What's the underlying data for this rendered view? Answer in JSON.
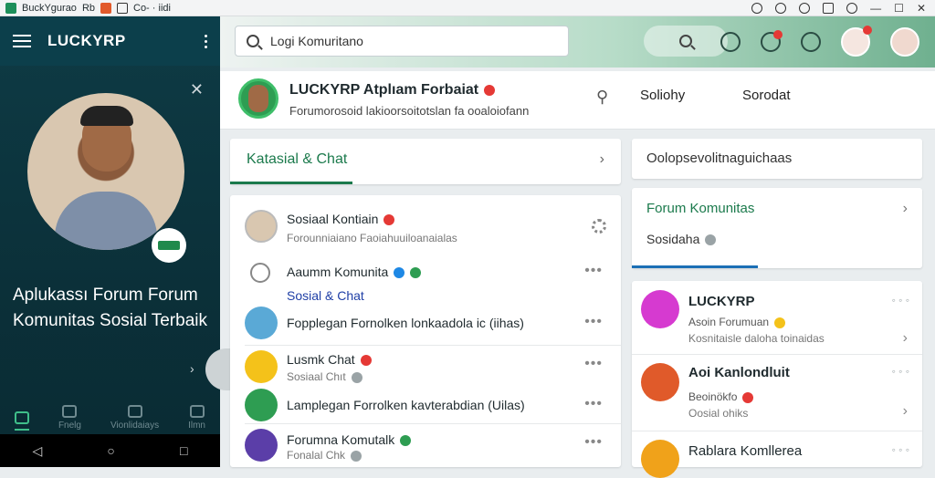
{
  "titlebar": {
    "app_title": "BuckYgurao",
    "app_suffix": "Rb",
    "extra": "Co- · iidi",
    "icons": [
      "minimize-icon",
      "maximize-icon",
      "close-icon"
    ],
    "min": "—",
    "max": "☐",
    "close": "✕"
  },
  "sidebar": {
    "brand": "LUCKYRP",
    "close": "✕",
    "tagline": "Aplukassı Forum Forum Komunitas Sosial Terbaik",
    "chevron": "›",
    "tabs": [
      {
        "label": "",
        "icon": "home-icon"
      },
      {
        "label": "Fnelg",
        "icon": "chat-icon"
      },
      {
        "label": "Vionlidaiays",
        "icon": "bell-icon"
      },
      {
        "label": "Ilmn",
        "icon": "grid-icon"
      }
    ],
    "nav": {
      "back": "◁",
      "home": "○",
      "recent": "□"
    }
  },
  "appbar": {
    "search_placeholder": "Logi Komuritano",
    "badge_count": "1"
  },
  "profile": {
    "title": "LUCKYRP Atplıam Forbaiat",
    "subtitle": "Forumorosoid lakioorsoitotslan fa ooaloiofann",
    "link1": "Soliohy",
    "link2": "Sorodat"
  },
  "tabs": {
    "active": "Katasial & Chat",
    "chevron": "›"
  },
  "list": [
    {
      "title": "Sosiaal Kontiain",
      "subtitle": "Forounniaiano Faoiahuuiloanaialas",
      "accent": "#e53935"
    },
    {
      "title": "Aaumm Komunita",
      "subtitle": "Sosial & Chat",
      "accent": "#1e88e5"
    },
    {
      "title": "Fopplegan Fornolken lonkaadola ic (iihas)",
      "subtitle": "",
      "accent": ""
    },
    {
      "title": "Lusmk Chat",
      "subtitle": "Sosiaal Chıt",
      "accent": "#e53935"
    },
    {
      "title": "Lamplegan Forrolken kavterabdian (Uilas)",
      "subtitle": "",
      "accent": ""
    },
    {
      "title": "Forumna Komutalk",
      "subtitle": "Fonalal Chk",
      "accent": "#2e9d52"
    }
  ],
  "list_more": "•••",
  "right": {
    "card1_label": "Oolopsevolitnaguichaas",
    "card2_label": "Forum Komunitas",
    "card2_sub": "Sosidaha",
    "chevron": "›"
  },
  "right_list": [
    {
      "title": "LUCKYRP",
      "sub1": "Asoin Forumuan",
      "sub2": "Kosnitaisle daloha toinaidas"
    },
    {
      "title": "Aoi Kanlondluit",
      "sub1": "Beoinökfo",
      "sub2": "Oosial ohiks"
    },
    {
      "title": "Rablara Komllerea",
      "sub1": "",
      "sub2": ""
    }
  ],
  "right_dots": "◦ ◦ ◦",
  "colors": {
    "accent": "#1b7a4c",
    "sidebar": "#0c3f4b",
    "notify": "#e53935"
  }
}
